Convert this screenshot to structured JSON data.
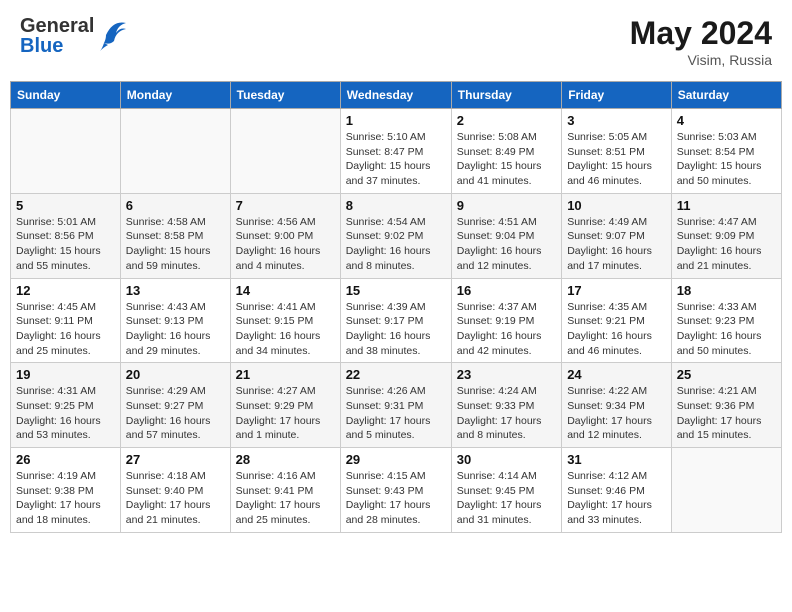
{
  "header": {
    "logo_general": "General",
    "logo_blue": "Blue",
    "month_title": "May 2024",
    "location": "Visim, Russia"
  },
  "days_of_week": [
    "Sunday",
    "Monday",
    "Tuesday",
    "Wednesday",
    "Thursday",
    "Friday",
    "Saturday"
  ],
  "weeks": [
    [
      {
        "day": "",
        "info": ""
      },
      {
        "day": "",
        "info": ""
      },
      {
        "day": "",
        "info": ""
      },
      {
        "day": "1",
        "info": "Sunrise: 5:10 AM\nSunset: 8:47 PM\nDaylight: 15 hours\nand 37 minutes."
      },
      {
        "day": "2",
        "info": "Sunrise: 5:08 AM\nSunset: 8:49 PM\nDaylight: 15 hours\nand 41 minutes."
      },
      {
        "day": "3",
        "info": "Sunrise: 5:05 AM\nSunset: 8:51 PM\nDaylight: 15 hours\nand 46 minutes."
      },
      {
        "day": "4",
        "info": "Sunrise: 5:03 AM\nSunset: 8:54 PM\nDaylight: 15 hours\nand 50 minutes."
      }
    ],
    [
      {
        "day": "5",
        "info": "Sunrise: 5:01 AM\nSunset: 8:56 PM\nDaylight: 15 hours\nand 55 minutes."
      },
      {
        "day": "6",
        "info": "Sunrise: 4:58 AM\nSunset: 8:58 PM\nDaylight: 15 hours\nand 59 minutes."
      },
      {
        "day": "7",
        "info": "Sunrise: 4:56 AM\nSunset: 9:00 PM\nDaylight: 16 hours\nand 4 minutes."
      },
      {
        "day": "8",
        "info": "Sunrise: 4:54 AM\nSunset: 9:02 PM\nDaylight: 16 hours\nand 8 minutes."
      },
      {
        "day": "9",
        "info": "Sunrise: 4:51 AM\nSunset: 9:04 PM\nDaylight: 16 hours\nand 12 minutes."
      },
      {
        "day": "10",
        "info": "Sunrise: 4:49 AM\nSunset: 9:07 PM\nDaylight: 16 hours\nand 17 minutes."
      },
      {
        "day": "11",
        "info": "Sunrise: 4:47 AM\nSunset: 9:09 PM\nDaylight: 16 hours\nand 21 minutes."
      }
    ],
    [
      {
        "day": "12",
        "info": "Sunrise: 4:45 AM\nSunset: 9:11 PM\nDaylight: 16 hours\nand 25 minutes."
      },
      {
        "day": "13",
        "info": "Sunrise: 4:43 AM\nSunset: 9:13 PM\nDaylight: 16 hours\nand 29 minutes."
      },
      {
        "day": "14",
        "info": "Sunrise: 4:41 AM\nSunset: 9:15 PM\nDaylight: 16 hours\nand 34 minutes."
      },
      {
        "day": "15",
        "info": "Sunrise: 4:39 AM\nSunset: 9:17 PM\nDaylight: 16 hours\nand 38 minutes."
      },
      {
        "day": "16",
        "info": "Sunrise: 4:37 AM\nSunset: 9:19 PM\nDaylight: 16 hours\nand 42 minutes."
      },
      {
        "day": "17",
        "info": "Sunrise: 4:35 AM\nSunset: 9:21 PM\nDaylight: 16 hours\nand 46 minutes."
      },
      {
        "day": "18",
        "info": "Sunrise: 4:33 AM\nSunset: 9:23 PM\nDaylight: 16 hours\nand 50 minutes."
      }
    ],
    [
      {
        "day": "19",
        "info": "Sunrise: 4:31 AM\nSunset: 9:25 PM\nDaylight: 16 hours\nand 53 minutes."
      },
      {
        "day": "20",
        "info": "Sunrise: 4:29 AM\nSunset: 9:27 PM\nDaylight: 16 hours\nand 57 minutes."
      },
      {
        "day": "21",
        "info": "Sunrise: 4:27 AM\nSunset: 9:29 PM\nDaylight: 17 hours\nand 1 minute."
      },
      {
        "day": "22",
        "info": "Sunrise: 4:26 AM\nSunset: 9:31 PM\nDaylight: 17 hours\nand 5 minutes."
      },
      {
        "day": "23",
        "info": "Sunrise: 4:24 AM\nSunset: 9:33 PM\nDaylight: 17 hours\nand 8 minutes."
      },
      {
        "day": "24",
        "info": "Sunrise: 4:22 AM\nSunset: 9:34 PM\nDaylight: 17 hours\nand 12 minutes."
      },
      {
        "day": "25",
        "info": "Sunrise: 4:21 AM\nSunset: 9:36 PM\nDaylight: 17 hours\nand 15 minutes."
      }
    ],
    [
      {
        "day": "26",
        "info": "Sunrise: 4:19 AM\nSunset: 9:38 PM\nDaylight: 17 hours\nand 18 minutes."
      },
      {
        "day": "27",
        "info": "Sunrise: 4:18 AM\nSunset: 9:40 PM\nDaylight: 17 hours\nand 21 minutes."
      },
      {
        "day": "28",
        "info": "Sunrise: 4:16 AM\nSunset: 9:41 PM\nDaylight: 17 hours\nand 25 minutes."
      },
      {
        "day": "29",
        "info": "Sunrise: 4:15 AM\nSunset: 9:43 PM\nDaylight: 17 hours\nand 28 minutes."
      },
      {
        "day": "30",
        "info": "Sunrise: 4:14 AM\nSunset: 9:45 PM\nDaylight: 17 hours\nand 31 minutes."
      },
      {
        "day": "31",
        "info": "Sunrise: 4:12 AM\nSunset: 9:46 PM\nDaylight: 17 hours\nand 33 minutes."
      },
      {
        "day": "",
        "info": ""
      }
    ]
  ]
}
